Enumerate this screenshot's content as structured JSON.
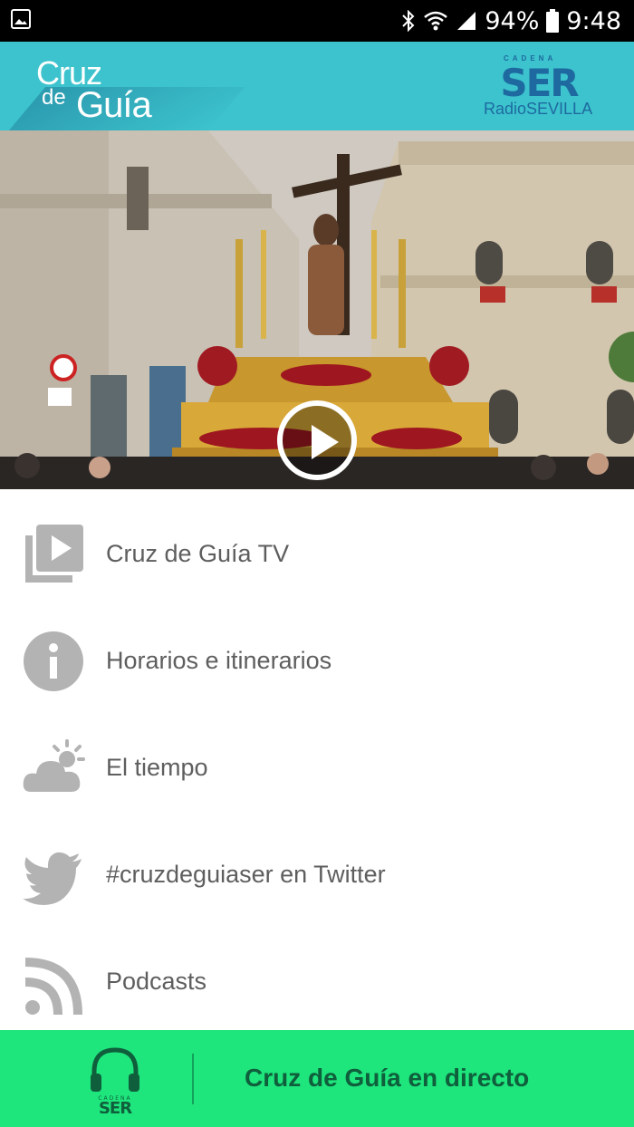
{
  "status_bar": {
    "battery": "94%",
    "time": "9:48",
    "icons": [
      "gallery-icon",
      "bluetooth-icon",
      "wifi-icon",
      "signal-icon",
      "battery-icon"
    ]
  },
  "header": {
    "logo": {
      "line1": "Cruz",
      "line2_small": "de",
      "line2_big": "Guía"
    },
    "brand": {
      "cadena": "CADENA",
      "name": "SER",
      "radio": "Radio",
      "city": "SEVILLA"
    },
    "background_color": "#3cc3cd"
  },
  "video": {
    "play_icon": "play-icon"
  },
  "menu": {
    "items": [
      {
        "label": "Cruz de Guía TV",
        "icon": "video-library-icon"
      },
      {
        "label": "Horarios e itinerarios",
        "icon": "info-icon"
      },
      {
        "label": "El tiempo",
        "icon": "weather-icon"
      },
      {
        "label": "#cruzdeguiaser en Twitter",
        "icon": "twitter-icon"
      },
      {
        "label": "Podcasts",
        "icon": "rss-icon"
      }
    ],
    "icon_color": "#b3b3b3",
    "text_color": "#5e5e5e"
  },
  "live_bar": {
    "label": "Cruz de Guía en directo",
    "logo_cadena": "CADENA",
    "logo_name": "SER",
    "background_color": "#1ee57c"
  }
}
